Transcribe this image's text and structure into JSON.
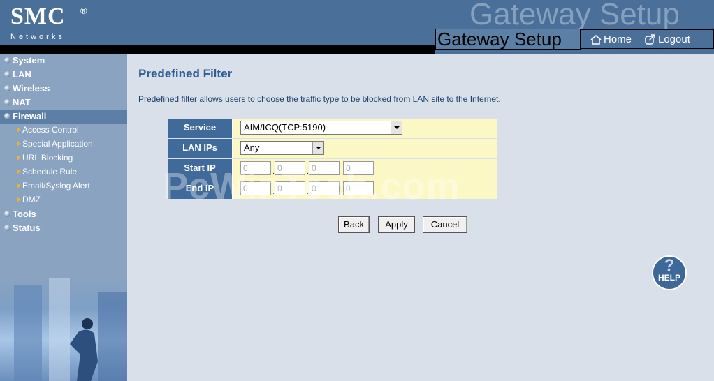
{
  "header": {
    "logo_text": "SMC",
    "logo_reg": "®",
    "logo_sub": "Networks",
    "ghost_title": "Gateway Setup",
    "title": "Gateway Setup",
    "home_label": "Home",
    "logout_label": "Logout"
  },
  "sidebar": {
    "menus": [
      {
        "label": "System"
      },
      {
        "label": "LAN"
      },
      {
        "label": "Wireless"
      },
      {
        "label": "NAT"
      },
      {
        "label": "Firewall"
      }
    ],
    "submenus": [
      {
        "label": "Access Control"
      },
      {
        "label": "Special Application"
      },
      {
        "label": "URL Blocking"
      },
      {
        "label": "Schedule Rule"
      },
      {
        "label": "Email/Syslog Alert"
      },
      {
        "label": "DMZ"
      }
    ],
    "menus_after": [
      {
        "label": "Tools"
      },
      {
        "label": "Status"
      }
    ]
  },
  "main": {
    "title": "Predefined Filter",
    "description": "Predefined filter allows users to choose the traffic type to be blocked from LAN site to the Internet.",
    "form": {
      "service_label": "Service",
      "service_value": "AIM/ICQ(TCP:5190)",
      "lanips_label": "LAN IPs",
      "lanips_value": "Any",
      "startip_label": "Start IP",
      "startip_octets": [
        "0",
        "0",
        "0",
        "0"
      ],
      "endip_label": "End IP",
      "endip_octets": [
        "0",
        "0",
        "0",
        "0"
      ]
    },
    "buttons": {
      "back": "Back",
      "apply": "Apply",
      "cancel": "Cancel"
    },
    "help_label": "HELP",
    "help_glyph": "?"
  },
  "watermark": "PcWinTech.com",
  "colors": {
    "header_bg": "#4a6f99",
    "sidebar_bg": "#8aa3c0",
    "label_bg": "#3f6a9a",
    "field_bg": "#fcf8c6",
    "title_color": "#2f5e93"
  }
}
